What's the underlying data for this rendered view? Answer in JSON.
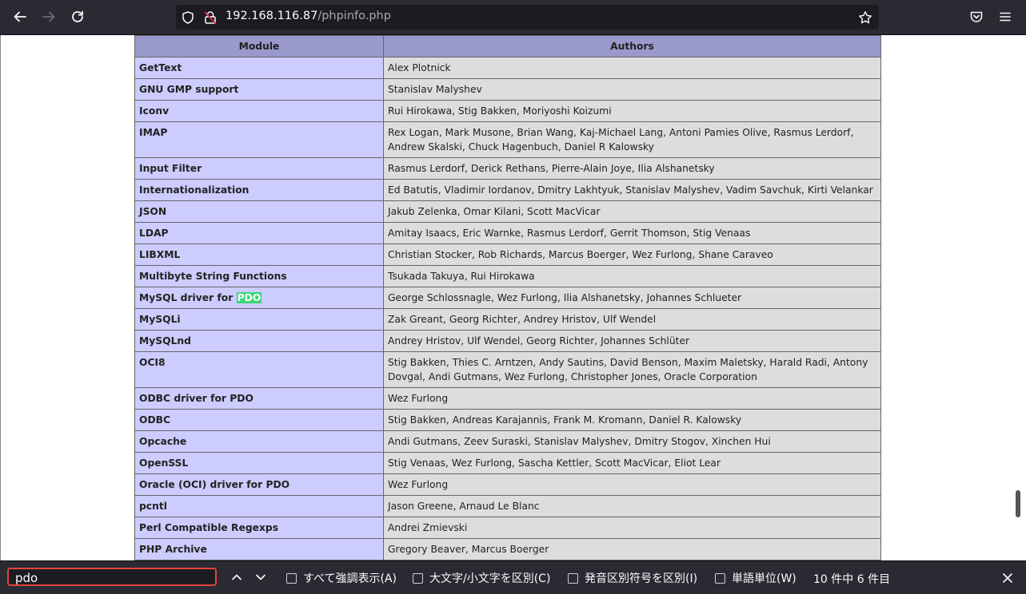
{
  "browser": {
    "url_host": "192.168.116.87",
    "url_path": "/phpinfo.php"
  },
  "table": {
    "headers": [
      "Module",
      "Authors"
    ],
    "rows": [
      {
        "module": "GetText",
        "authors": "Alex Plotnick"
      },
      {
        "module": "GNU GMP support",
        "authors": "Stanislav Malyshev"
      },
      {
        "module": "Iconv",
        "authors": "Rui Hirokawa, Stig Bakken, Moriyoshi Koizumi"
      },
      {
        "module": "IMAP",
        "authors": "Rex Logan, Mark Musone, Brian Wang, Kaj-Michael Lang, Antoni Pamies Olive, Rasmus Lerdorf, Andrew Skalski, Chuck Hagenbuch, Daniel R Kalowsky"
      },
      {
        "module": "Input Filter",
        "authors": "Rasmus Lerdorf, Derick Rethans, Pierre-Alain Joye, Ilia Alshanetsky"
      },
      {
        "module": "Internationalization",
        "authors": "Ed Batutis, Vladimir Iordanov, Dmitry Lakhtyuk, Stanislav Malyshev, Vadim Savchuk, Kirti Velankar"
      },
      {
        "module": "JSON",
        "authors": "Jakub Zelenka, Omar Kilani, Scott MacVicar"
      },
      {
        "module": "LDAP",
        "authors": "Amitay Isaacs, Eric Warnke, Rasmus Lerdorf, Gerrit Thomson, Stig Venaas"
      },
      {
        "module": "LIBXML",
        "authors": "Christian Stocker, Rob Richards, Marcus Boerger, Wez Furlong, Shane Caraveo"
      },
      {
        "module": "Multibyte String Functions",
        "authors": "Tsukada Takuya, Rui Hirokawa"
      },
      {
        "module": "MySQL driver for ",
        "module_highlight": "PDO",
        "authors": "George Schlossnagle, Wez Furlong, Ilia Alshanetsky, Johannes Schlueter"
      },
      {
        "module": "MySQLi",
        "authors": "Zak Greant, Georg Richter, Andrey Hristov, Ulf Wendel"
      },
      {
        "module": "MySQLnd",
        "authors": "Andrey Hristov, Ulf Wendel, Georg Richter, Johannes Schlüter"
      },
      {
        "module": "OCI8",
        "authors": "Stig Bakken, Thies C. Arntzen, Andy Sautins, David Benson, Maxim Maletsky, Harald Radi, Antony Dovgal, Andi Gutmans, Wez Furlong, Christopher Jones, Oracle Corporation"
      },
      {
        "module": "ODBC driver for PDO",
        "authors": "Wez Furlong"
      },
      {
        "module": "ODBC",
        "authors": "Stig Bakken, Andreas Karajannis, Frank M. Kromann, Daniel R. Kalowsky"
      },
      {
        "module": "Opcache",
        "authors": "Andi Gutmans, Zeev Suraski, Stanislav Malyshev, Dmitry Stogov, Xinchen Hui"
      },
      {
        "module": "OpenSSL",
        "authors": "Stig Venaas, Wez Furlong, Sascha Kettler, Scott MacVicar, Eliot Lear"
      },
      {
        "module": "Oracle (OCI) driver for PDO",
        "authors": "Wez Furlong"
      },
      {
        "module": "pcntl",
        "authors": "Jason Greene, Arnaud Le Blanc"
      },
      {
        "module": "Perl Compatible Regexps",
        "authors": "Andrei Zmievski"
      },
      {
        "module": "PHP Archive",
        "authors": "Gregory Beaver, Marcus Boerger"
      }
    ]
  },
  "findbar": {
    "query": "pdo",
    "options": [
      "すべて強調表示(A)",
      "大文字/小文字を区別(C)",
      "発音区別符号を区別(I)",
      "単語単位(W)"
    ],
    "match_count": "10 件中 6 件目"
  }
}
